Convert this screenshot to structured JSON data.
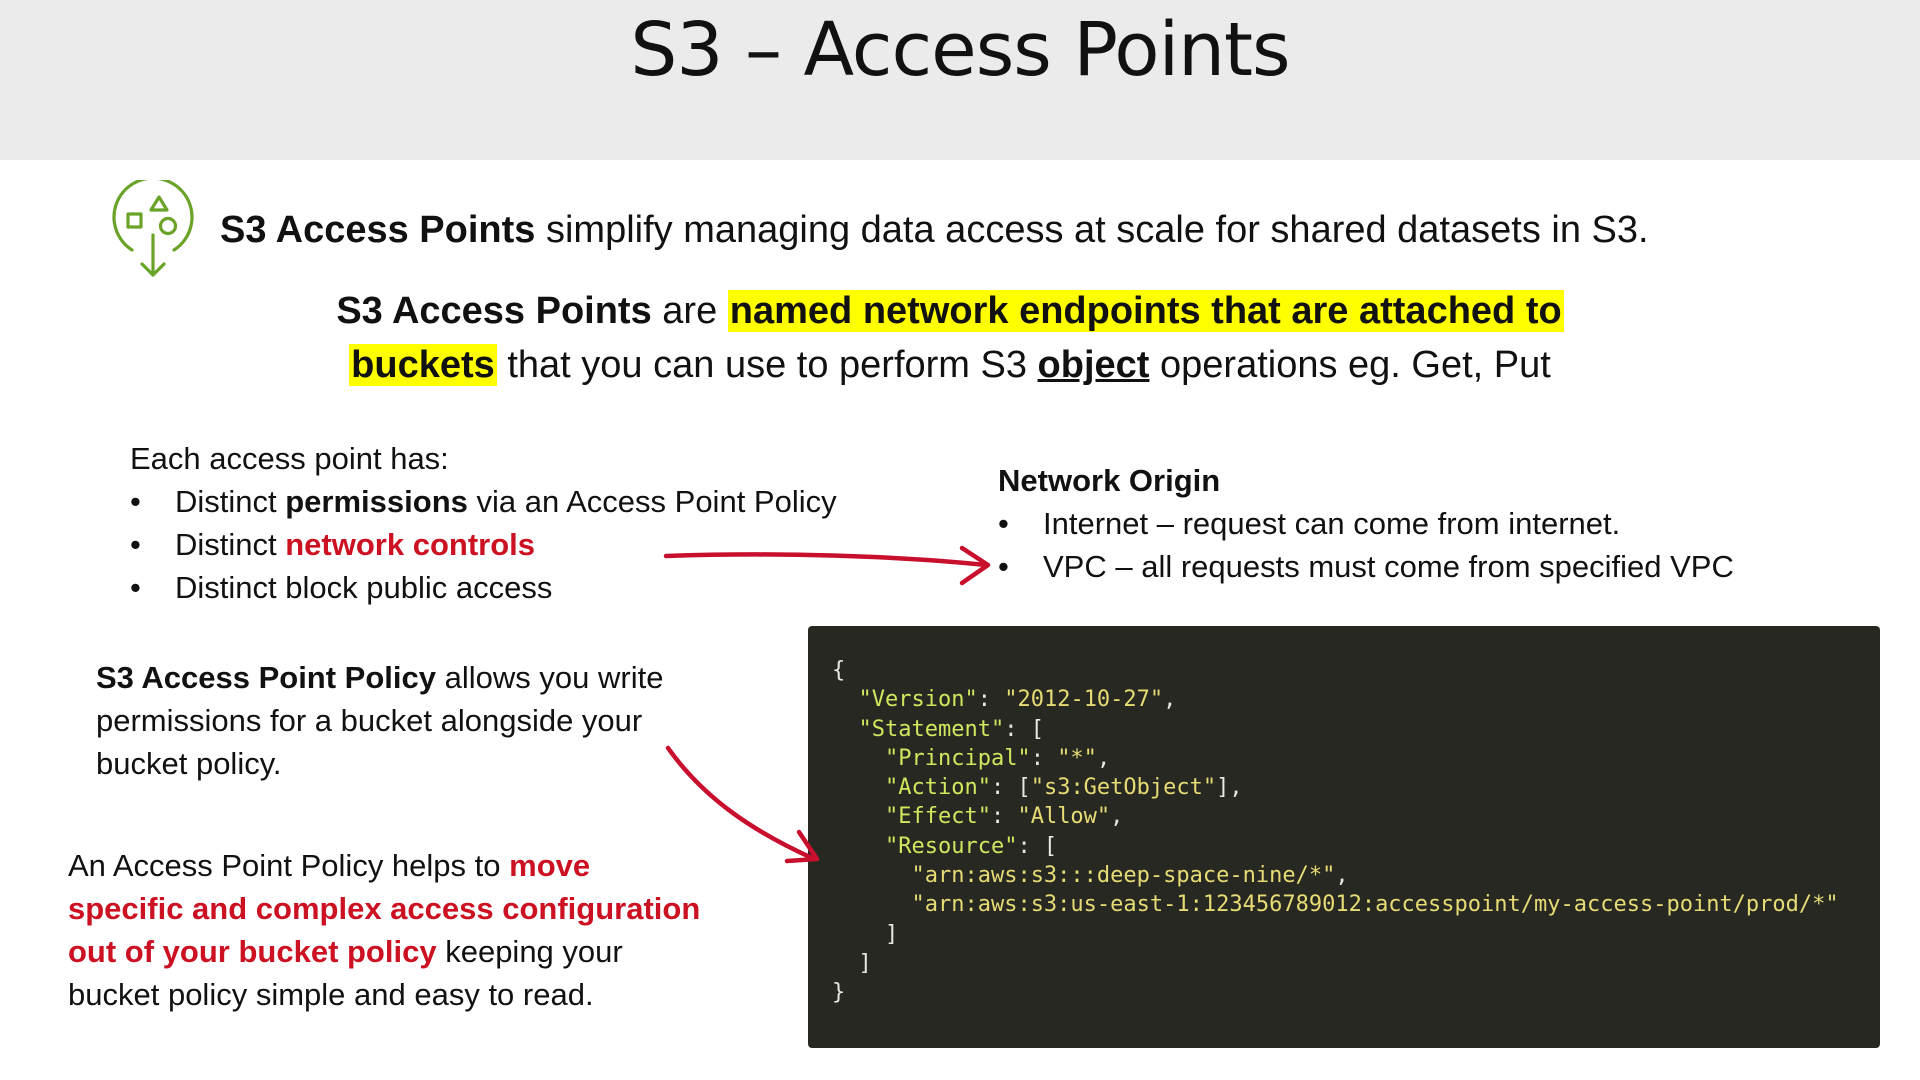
{
  "title": "S3 – Access Points",
  "intro": {
    "bold": "S3 Access Points",
    "rest": " simplify managing data access at scale for shared datasets in S3."
  },
  "definition": {
    "bold": "S3 Access Points",
    "part1": " are ",
    "highlight1": "named network endpoints that are attached to",
    "highlight2": "buckets",
    "part2": " that you can use to perform S3 ",
    "underlined": "object",
    "part3": " operations eg. Get, Put"
  },
  "each_access_point": {
    "heading": "Each access point has:",
    "bullet1": {
      "prefix": "Distinct ",
      "bold": "permissions",
      "suffix": " via an Access Point Policy"
    },
    "bullet2": {
      "prefix": "Distinct ",
      "red": "network controls"
    },
    "bullet3": {
      "text": "Distinct block public access"
    }
  },
  "network_origin": {
    "heading": "Network Origin",
    "items": [
      "Internet – request can come from internet.",
      "VPC – all requests must come from specified VPC"
    ]
  },
  "policy_text": {
    "bold": "S3 Access Point Policy",
    "rest": " allows you write permissions for a bucket alongside your bucket policy."
  },
  "helper_text": {
    "prefix": "An Access Point Policy helps to ",
    "red": "move specific and complex access configuration out of your bucket policy",
    "suffix": " keeping your bucket policy simple and easy to read."
  },
  "code": {
    "version_key": "\"Version\"",
    "version_val": "\"2012-10-27\"",
    "statement_key": "\"Statement\"",
    "principal_key": "\"Principal\"",
    "principal_val": "\"*\"",
    "action_key": "\"Action\"",
    "action_val": "\"s3:GetObject\"",
    "effect_key": "\"Effect\"",
    "effect_val": "\"Allow\"",
    "resource_key": "\"Resource\"",
    "resource_1": "\"arn:aws:s3:::deep-space-nine/*\"",
    "resource_2": "\"arn:aws:s3:us-east-1:123456789012:accesspoint/my-access-point/prod/*\""
  },
  "colors": {
    "highlight": "#ffff00",
    "emphasis_red": "#cc1122",
    "code_bg": "#272822",
    "icon_green": "#6aa327",
    "title_band": "#ebebeb"
  },
  "icons": [
    "access-points-icon"
  ]
}
